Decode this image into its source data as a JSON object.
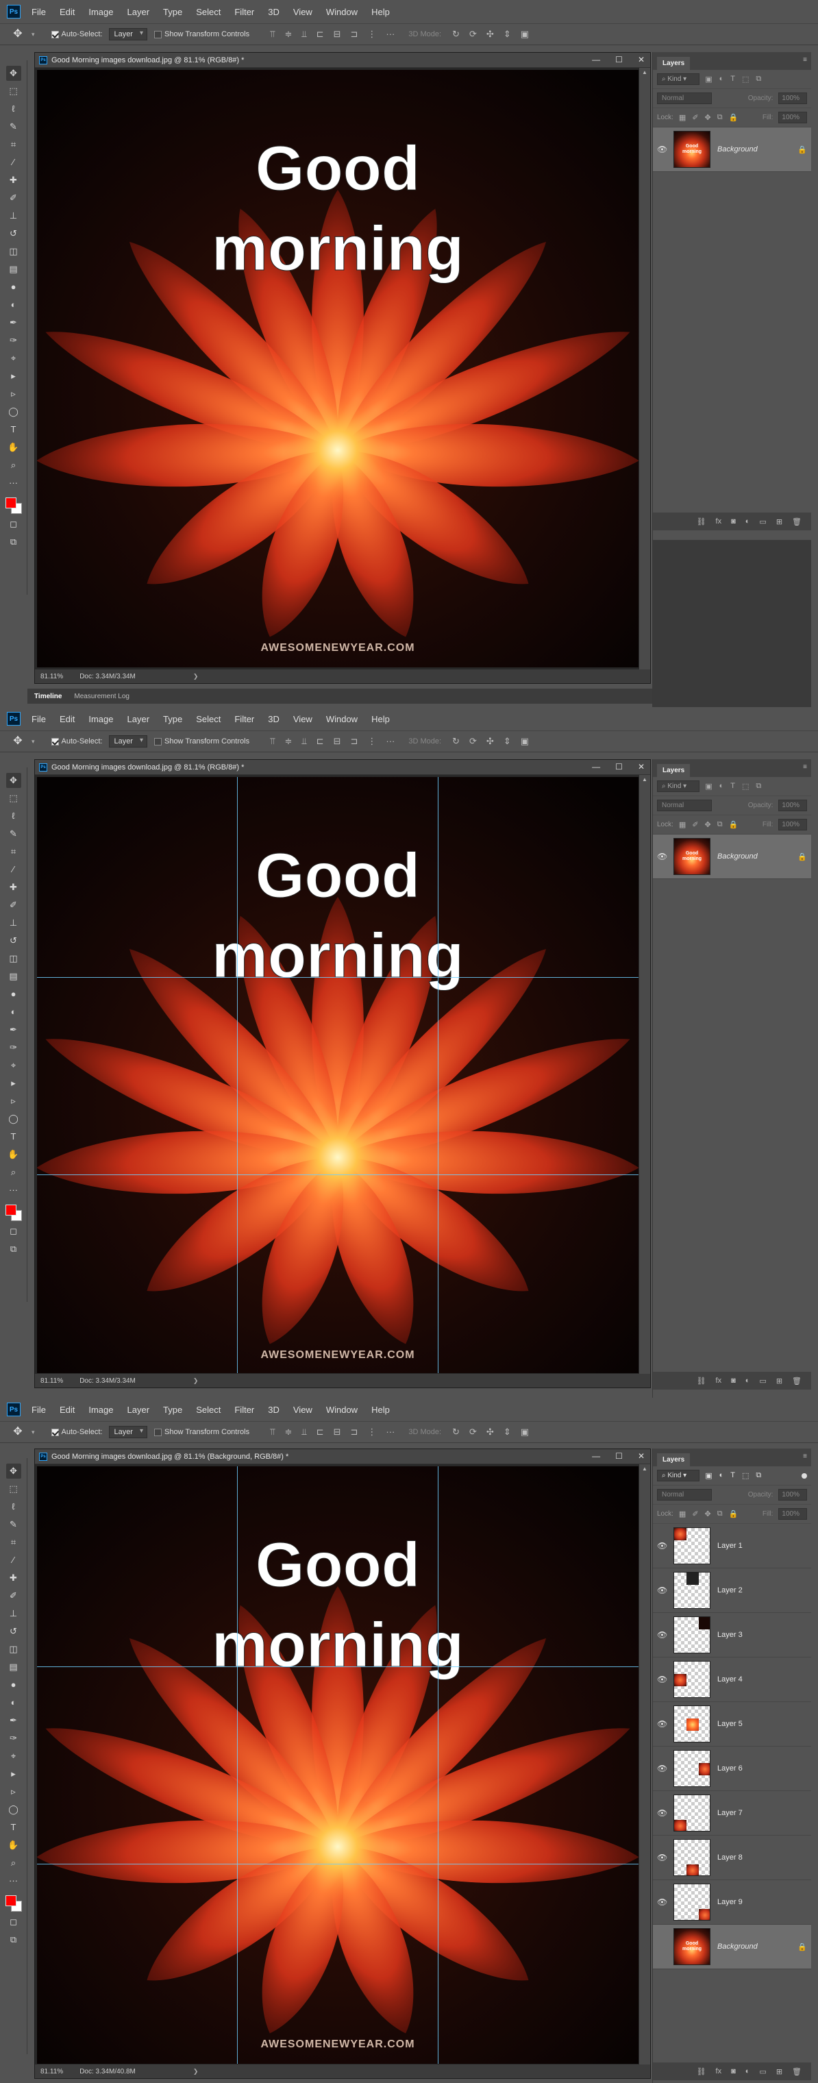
{
  "menu": [
    "File",
    "Edit",
    "Image",
    "Layer",
    "Type",
    "Select",
    "Filter",
    "3D",
    "View",
    "Window",
    "Help"
  ],
  "options": {
    "auto_select_label": "Auto-Select:",
    "auto_select_value": "Layer",
    "show_transform_label": "Show Transform Controls",
    "mode_3d_label": "3D Mode:"
  },
  "tools": [
    "move-tool",
    "marquee-tool",
    "lasso-tool",
    "quick-select-tool",
    "crop-tool",
    "eyedropper-tool",
    "spot-heal-tool",
    "brush-tool",
    "clone-stamp-tool",
    "history-brush-tool",
    "eraser-tool",
    "gradient-tool",
    "blur-tool",
    "dodge-tool",
    "pen-tool",
    "type-tool",
    "path-select-tool",
    "shape-tool",
    "hand-tool",
    "zoom-tool"
  ],
  "colors": {
    "foreground": "#ff0000",
    "background": "#ffffff",
    "guide": "#6ecfff",
    "panel": "#535353"
  },
  "image": {
    "line1": "Good",
    "line2": "morning",
    "watermark": "AWESOMENEWYEAR.COM"
  },
  "screens": [
    {
      "doc_title": "Good Morning images download.jpg @ 81.1% (RGB/8#) *",
      "zoom": "81.11%",
      "doc_size": "Doc: 3.34M/3.34M",
      "bottom_tabs": [
        "Timeline",
        "Measurement Log"
      ]
    },
    {
      "doc_title": "Good Morning images download.jpg @ 81.1% (RGB/8#) *",
      "zoom": "81.11%",
      "doc_size": "Doc: 3.34M/3.34M"
    },
    {
      "doc_title": "Good Morning images download.jpg @ 81.1% (Background, RGB/8#) *",
      "zoom": "81.11%",
      "doc_size": "Doc: 3.34M/40.8M"
    }
  ],
  "layers_panel": {
    "tab": "Layers",
    "kind": "Kind",
    "blend": "Normal",
    "opacity_label": "Opacity:",
    "opacity_value": "100%",
    "lock_label": "Lock:",
    "fill_label": "Fill:",
    "fill_value": "100%",
    "background_layer": "Background",
    "thumb_text_1": "Good",
    "thumb_text_2": "morning",
    "layers": [
      "Layer 1",
      "Layer 2",
      "Layer 3",
      "Layer 4",
      "Layer 5",
      "Layer 6",
      "Layer 7",
      "Layer 8",
      "Layer 9"
    ]
  }
}
